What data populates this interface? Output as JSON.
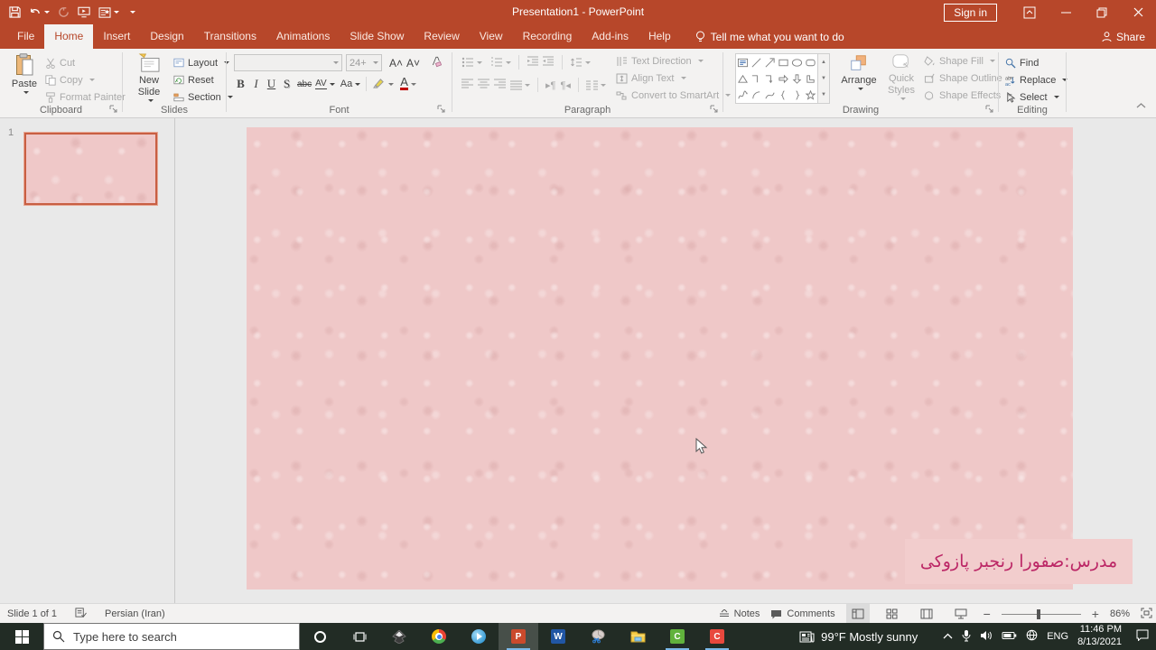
{
  "title_bar": {
    "title": "Presentation1 - PowerPoint",
    "sign_in_label": "Sign in"
  },
  "ribbon": {
    "tabs": [
      "File",
      "Home",
      "Insert",
      "Design",
      "Transitions",
      "Animations",
      "Slide Show",
      "Review",
      "View",
      "Recording",
      "Add-ins",
      "Help"
    ],
    "tell_me_label": "Tell me what you want to do",
    "share_label": "Share",
    "clipboard": {
      "group_label": "Clipboard",
      "paste_label": "Paste",
      "cut_label": "Cut",
      "copy_label": "Copy",
      "format_painter_label": "Format Painter"
    },
    "slides": {
      "group_label": "Slides",
      "new_slide_label": "New Slide",
      "layout_label": "Layout",
      "reset_label": "Reset",
      "section_label": "Section"
    },
    "font": {
      "group_label": "Font",
      "font_size_value": "24+",
      "bold_label": "B",
      "italic_label": "I",
      "underline_label": "U",
      "shadow_label": "S",
      "strikethrough_label": "abc",
      "spacing_label": "AV",
      "change_case_label": "Aa",
      "font_color_label": "A"
    },
    "paragraph": {
      "group_label": "Paragraph",
      "text_direction_label": "Text Direction",
      "align_text_label": "Align Text",
      "convert_smartart_label": "Convert to SmartArt"
    },
    "drawing": {
      "group_label": "Drawing",
      "arrange_label": "Arrange",
      "quick_styles_label": "Quick Styles",
      "shape_fill_label": "Shape Fill",
      "shape_outline_label": "Shape Outline",
      "shape_effects_label": "Shape Effects"
    },
    "editing": {
      "group_label": "Editing",
      "find_label": "Find",
      "replace_label": "Replace",
      "select_label": "Select"
    }
  },
  "slides_panel": {
    "slide_number": "1"
  },
  "slide": {
    "credit_text": "مدرس:صفورا رنجبر پازوکی"
  },
  "status_bar": {
    "slide_indicator": "Slide 1 of 1",
    "language": "Persian (Iran)",
    "notes_label": "Notes",
    "comments_label": "Comments",
    "zoom_level": "86%"
  },
  "taskbar": {
    "search_placeholder": "Type here to search",
    "weather_text": "99°F Mostly sunny",
    "language_code": "ENG",
    "time": "11:46 PM",
    "date": "8/13/2021"
  }
}
